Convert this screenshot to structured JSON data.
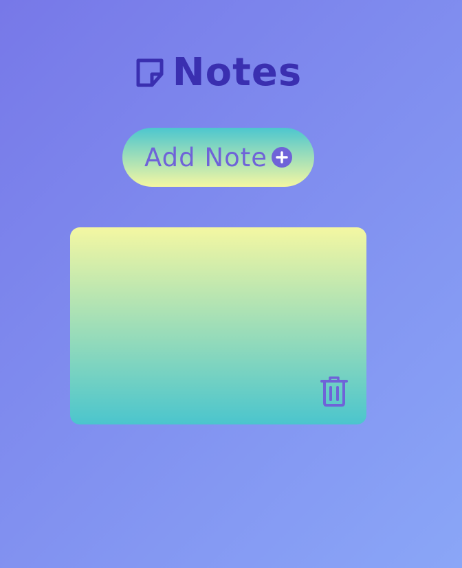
{
  "header": {
    "title": "Notes",
    "icon": "sticky-note-icon"
  },
  "toolbar": {
    "add_label": "Add Note",
    "add_icon": "plus-circle-icon"
  },
  "notes": [
    {
      "text": "",
      "delete_icon": "trash-icon"
    }
  ],
  "colors": {
    "background_start": "#7778e8",
    "background_end": "#8aa6f7",
    "title": "#3a2fb0",
    "accent": "#6f63d8",
    "gradient_yellow": "#f4f7a2",
    "gradient_teal": "#4bc5cd"
  }
}
